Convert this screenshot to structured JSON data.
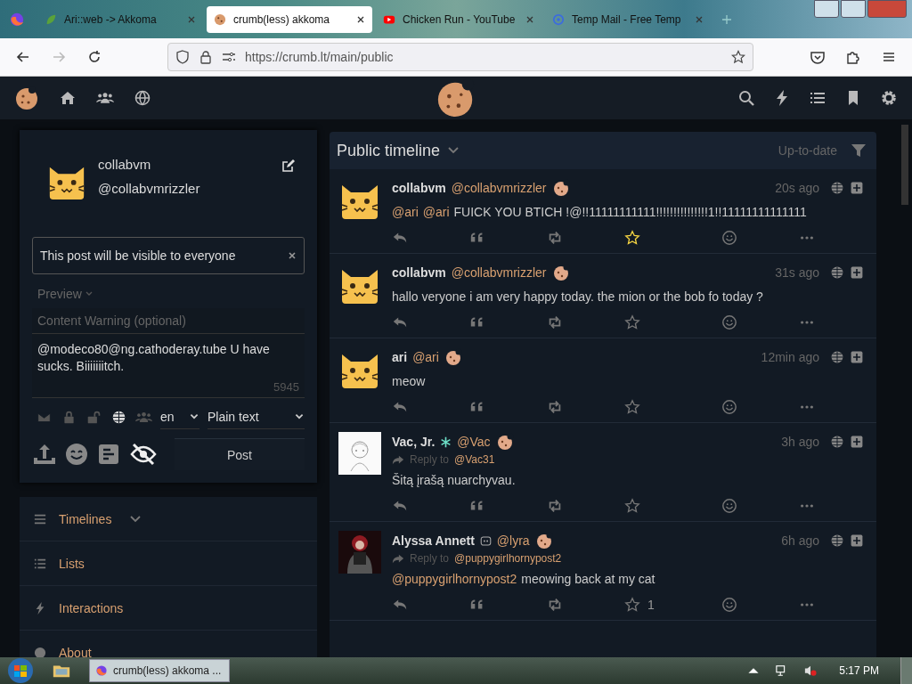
{
  "browser": {
    "tabs": [
      {
        "title": "Ari::web -> Akkoma",
        "kind": "leaf",
        "selected": false
      },
      {
        "title": "crumb(less) akkoma",
        "kind": "cookie",
        "selected": true
      },
      {
        "title": "Chicken Run - YouTube",
        "kind": "play",
        "selected": false
      },
      {
        "title": "Temp Mail - Free Temp",
        "kind": "at",
        "selected": false
      }
    ],
    "url": "https://crumb.lt/main/public"
  },
  "user": {
    "name": "collabvm",
    "handle": "@collabvmrizzler"
  },
  "compose": {
    "scope_notice": "This post will be visible to everyone",
    "preview_label": "Preview",
    "cw_placeholder": "Content Warning (optional)",
    "text": "@modeco80@ng.cathoderay.tube U have sucks. Biiiiiiitch.",
    "char_count": "5945",
    "scopes": [
      {
        "kind": "direct",
        "selected": false
      },
      {
        "kind": "private",
        "selected": false
      },
      {
        "kind": "unlisted",
        "selected": false
      },
      {
        "kind": "public",
        "selected": true
      },
      {
        "kind": "local",
        "selected": false
      }
    ],
    "language": "en",
    "format": "Plain text",
    "post_button": "Post"
  },
  "nav": [
    {
      "label": "Timelines",
      "kind": "menu"
    },
    {
      "label": "Lists",
      "kind": "list"
    },
    {
      "label": "Interactions",
      "kind": "bolt"
    },
    {
      "label": "About",
      "kind": "info"
    }
  ],
  "timeline": {
    "title": "Public timeline",
    "status": "Up-to-date",
    "posts": [
      {
        "name": "collabvm",
        "handle": "@collabvmrizzler",
        "kind": "cat",
        "time": "20s ago",
        "mentions": [
          "@ari",
          "@ari"
        ],
        "text": "FUICK YOU BTICH !@!!11111111111!!!!!!!!!!!!!!!1!!11111111111111",
        "star_highlighted": true
      },
      {
        "name": "collabvm",
        "handle": "@collabvmrizzler",
        "kind": "cat",
        "time": "31s ago",
        "text": "hallo veryone i am very happy today. the mion or the bob fo today ?",
        "star_highlighted": false
      },
      {
        "name": "ari",
        "handle": "@ari",
        "kind": "cat",
        "time": "12min ago",
        "text": "meow",
        "star_highlighted": false
      },
      {
        "name": "Vac, Jr.",
        "handle": "@Vac",
        "kind": "sketch",
        "time": "3h ago",
        "reply_label": "Reply to",
        "reply_to": "@Vac31",
        "text": "Šitą įrašą nuarchyvau.",
        "star_highlighted": false
      },
      {
        "name": "Alyssa Annett",
        "handle": "@lyra",
        "kind": "portrait",
        "time": "6h ago",
        "reply_label": "Reply to",
        "reply_to": "@puppygirlhornypost2",
        "mentions": [
          "@puppygirlhornypost2"
        ],
        "text": "meowing back at my cat",
        "star_highlighted": false,
        "favorites": "1"
      }
    ]
  },
  "taskbar": {
    "task": "crumb(less) akkoma ...",
    "clock": "5:17 PM"
  }
}
